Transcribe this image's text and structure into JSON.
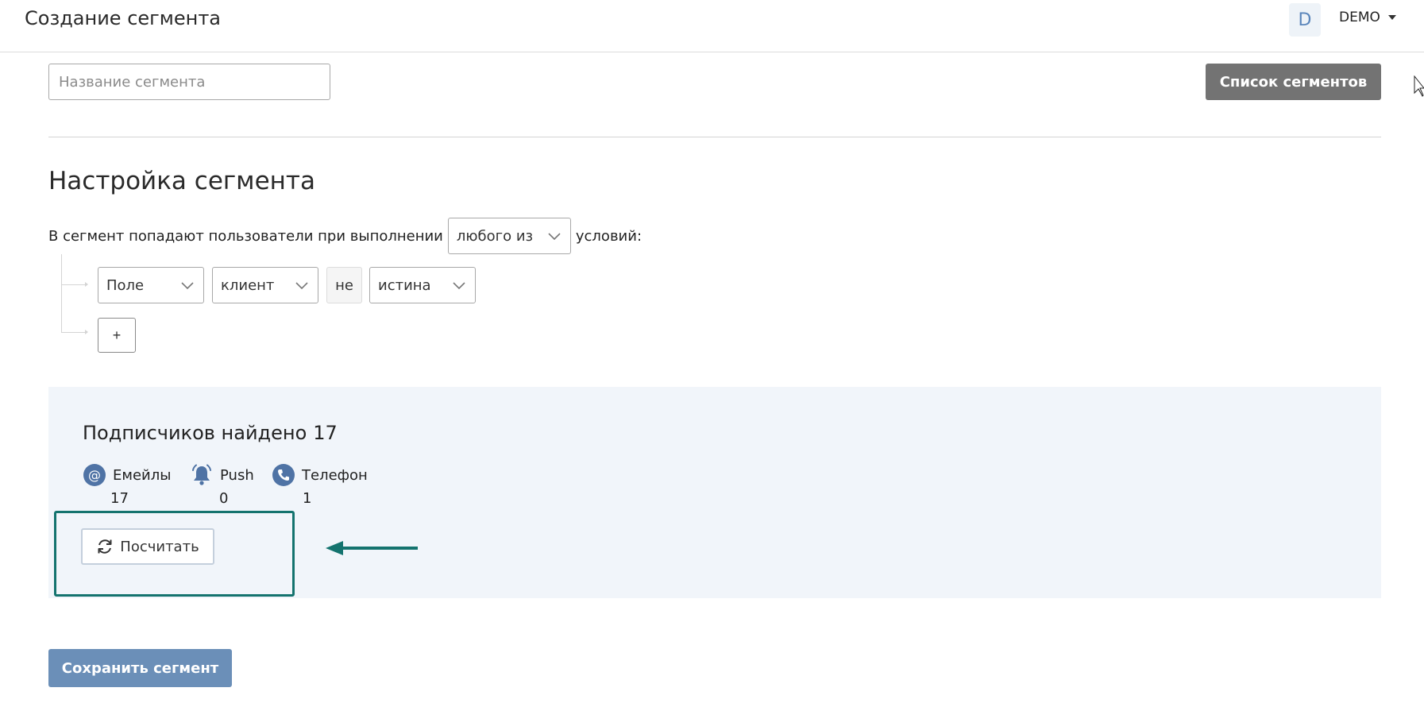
{
  "header": {
    "title": "Создание сегмента",
    "avatar_letter": "D",
    "account_name": "DEMO"
  },
  "segment_name": {
    "placeholder": "Название сегмента",
    "value": ""
  },
  "list_button_label": "Список сегментов",
  "settings": {
    "title": "Настройка сегмента",
    "rule_prefix": "В сегмент попадают пользователи при выполнении",
    "rule_mode": "любого из",
    "rule_suffix": "условий:",
    "condition": {
      "field": "Поле",
      "entity": "клиент",
      "negation": "не",
      "value": "истина"
    },
    "add_label": "+"
  },
  "results": {
    "found_label": "Подписчиков найдено",
    "found_count": "17",
    "channels": [
      {
        "name": "Емейлы",
        "count": "17",
        "icon": "email-at-icon"
      },
      {
        "name": "Push",
        "count": "0",
        "icon": "push-bell-icon"
      },
      {
        "name": "Телефон",
        "count": "1",
        "icon": "phone-icon"
      }
    ],
    "calc_label": "Посчитать"
  },
  "save_label": "Сохранить сегмент",
  "colors": {
    "accent": "#6b8fb8",
    "icon": "#4f73a5",
    "highlight": "#14736e",
    "panel_bg": "#f1f5fa",
    "secondary_button": "#737373"
  }
}
